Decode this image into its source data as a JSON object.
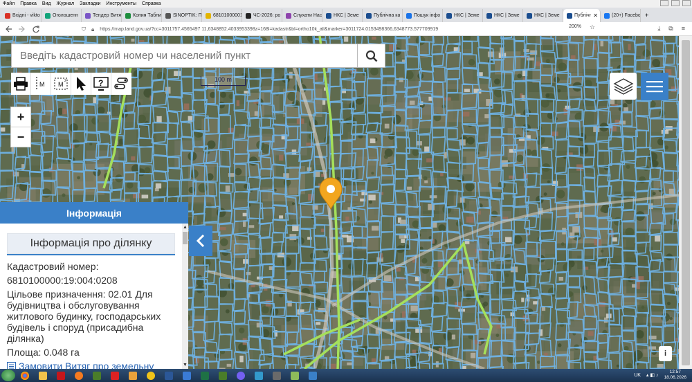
{
  "menubar": {
    "items": [
      "Файл",
      "Правка",
      "Вид",
      "Журнал",
      "Закладки",
      "Инструменты",
      "Справка"
    ]
  },
  "tabs": [
    {
      "label": "Вхідні - vikto",
      "color": "#d93025"
    },
    {
      "label": "Оголошенн",
      "color": "#12a47b"
    },
    {
      "label": "Тендер Витя",
      "color": "#7a55c7"
    },
    {
      "label": "Копия Табли",
      "color": "#1e8e3e"
    },
    {
      "label": "SINOPTIK: По",
      "color": "#555555"
    },
    {
      "label": "68101000001",
      "color": "#e3b400"
    },
    {
      "label": "ЧС-2026: ро",
      "color": "#222222"
    },
    {
      "label": "Слухати Нас",
      "color": "#8e44ad"
    },
    {
      "label": "НКС | Земе",
      "color": "#1a4d8f"
    },
    {
      "label": "Публічна ка",
      "color": "#1a4d8f"
    },
    {
      "label": "Пошук інфо",
      "color": "#1a73e8"
    },
    {
      "label": "НКС | Земе",
      "color": "#1a4d8f"
    },
    {
      "label": "НКС | Земе",
      "color": "#1a4d8f"
    },
    {
      "label": "НКС | Земе",
      "color": "#1a4d8f"
    },
    {
      "label": "Публічн",
      "color": "#1a4d8f",
      "active": true
    },
    {
      "label": "(20+) Facebo",
      "color": "#1877f2"
    }
  ],
  "address": {
    "url": "https://map.land.gov.ua/?cc=3011757.4565497 11,6348852.4033953398z=168l=kadastr&bl=ortho10k_all&marker=3011724.0153498366,6348773.577709919",
    "zoom": "200%"
  },
  "search": {
    "placeholder": "Введіть кадастровий номер чи населений пункт"
  },
  "map": {
    "scale_label": "100 m"
  },
  "zoom": {
    "plus": "+",
    "minus": "−"
  },
  "panel": {
    "header": "Інформація",
    "section_title": "Інформація про ділянку",
    "cadastral_label": "Кадастровий номер:",
    "cadastral_number": "6810100000:19:004:0208",
    "purpose": "Цільове призначення: 02.01 Для будівництва і обслуговування житлового будинку, господарських будівель і споруд (присадибна ділянка)",
    "area": "Площа: 0.048 га",
    "order_link": "Замовити Витяг про земельну ділянку"
  },
  "info_corner": "i",
  "tray": {
    "lang": "UK",
    "time": "12:57",
    "date": "18.06.2026"
  },
  "colors": {
    "accent": "#3a80c8",
    "parcel": "#6fb3e6",
    "boundary": "#a5e05b",
    "marker": "#f2a61f"
  }
}
